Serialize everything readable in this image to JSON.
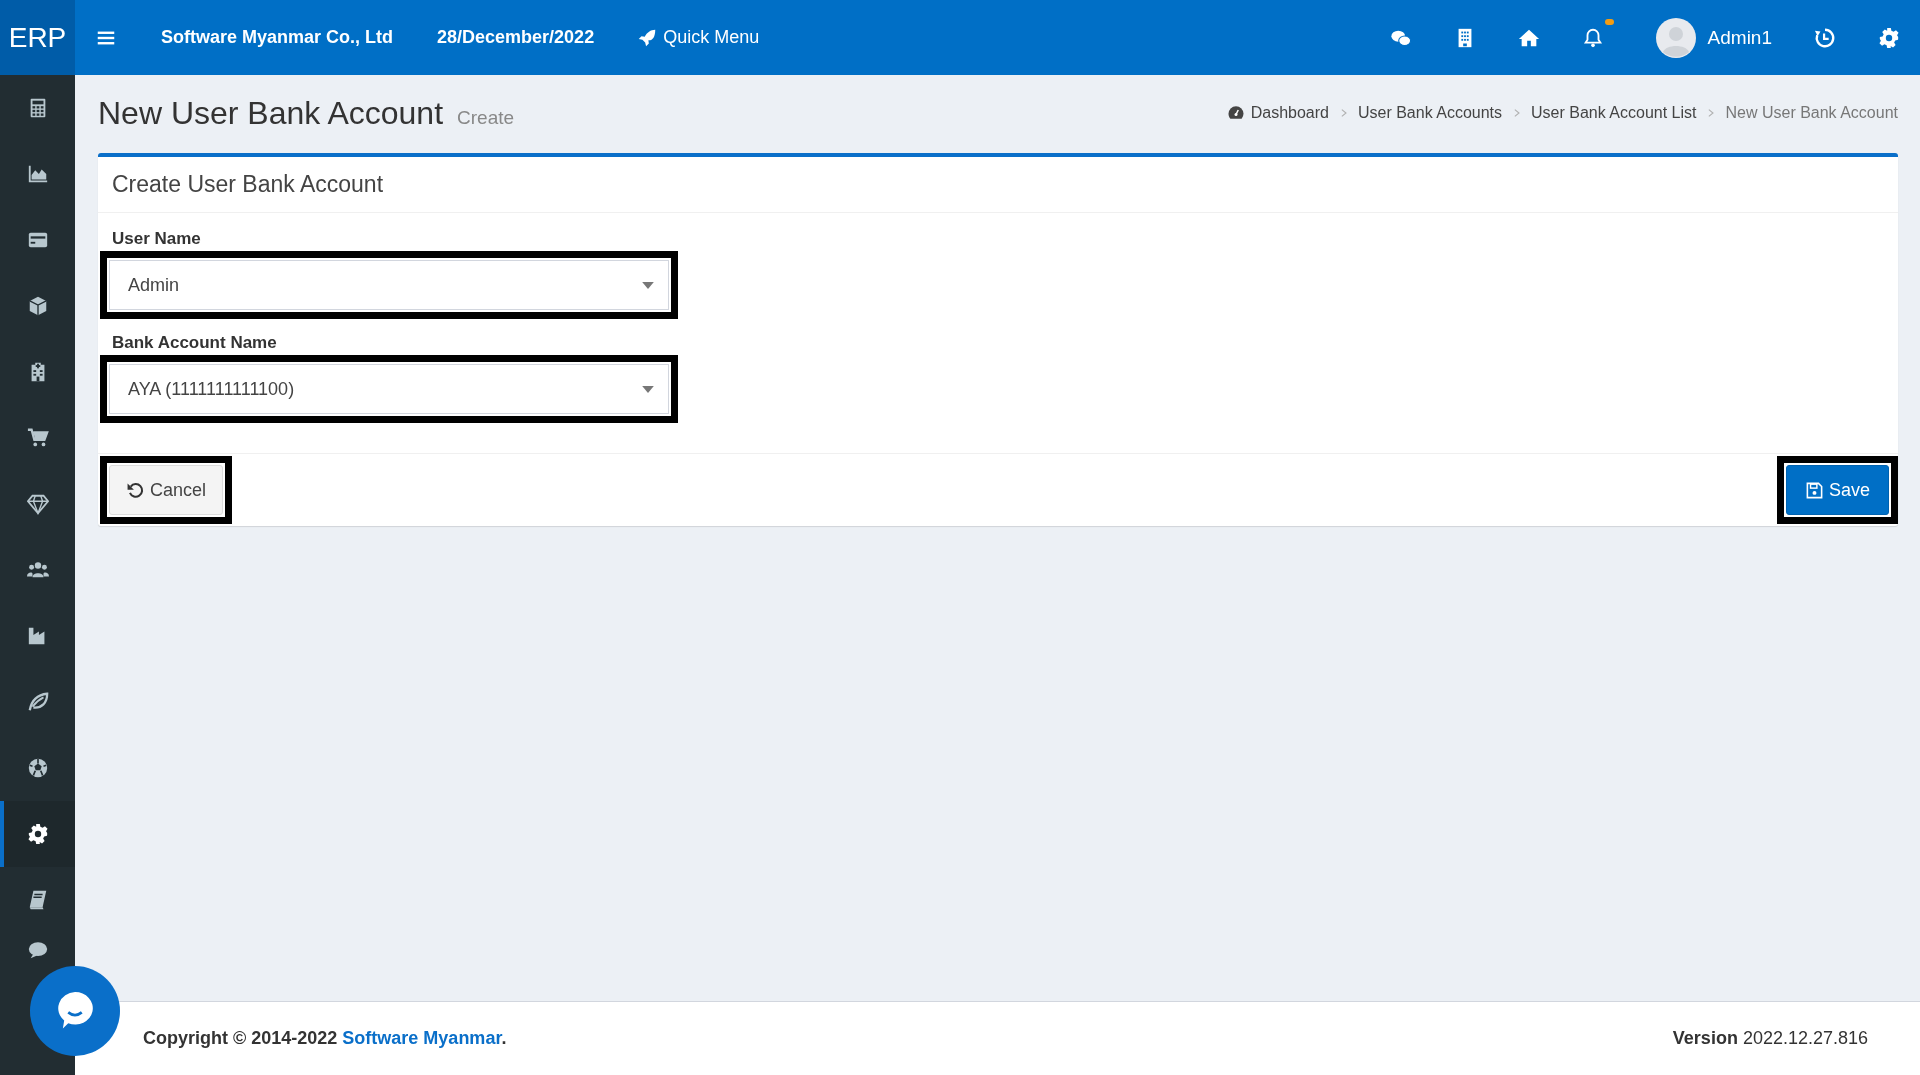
{
  "topbar": {
    "logo": "ERP",
    "company": "Software Myanmar Co., Ltd",
    "date": "28/December/2022",
    "quick_menu": "Quick Menu",
    "notification_dot": true,
    "user": "Admin1"
  },
  "sidebar": {
    "items": [
      {
        "selected": false
      },
      {
        "selected": false
      },
      {
        "selected": false
      },
      {
        "selected": false
      },
      {
        "selected": false
      },
      {
        "selected": false
      },
      {
        "selected": false
      },
      {
        "selected": false
      },
      {
        "selected": false
      },
      {
        "selected": false
      },
      {
        "selected": false
      },
      {
        "selected": true
      },
      {
        "selected": false
      },
      {
        "selected": false
      }
    ]
  },
  "page": {
    "title": "New User Bank Account",
    "subtitle": "Create"
  },
  "breadcrumb": [
    {
      "label": "Dashboard"
    },
    {
      "label": "User Bank Accounts"
    },
    {
      "label": "User Bank Account List"
    },
    {
      "label": "New User Bank Account"
    }
  ],
  "form": {
    "title": "Create User Bank Account",
    "fields": [
      {
        "label": "User Name",
        "value": "Admin",
        "highlighted": true
      },
      {
        "label": "Bank Account Name",
        "value": "AYA (1111111111100)",
        "highlighted": true
      }
    ],
    "buttons": [
      {
        "kind": "cancel",
        "label": "Cancel",
        "highlighted": true
      },
      {
        "kind": "save",
        "label": "Save",
        "highlighted": true
      }
    ]
  },
  "footer": {
    "copyright": "Copyright © 2014-2022 ",
    "company_link": "Software Myanmar",
    "period": ".",
    "version": "**Version** 2022.12.27.816"
  }
}
